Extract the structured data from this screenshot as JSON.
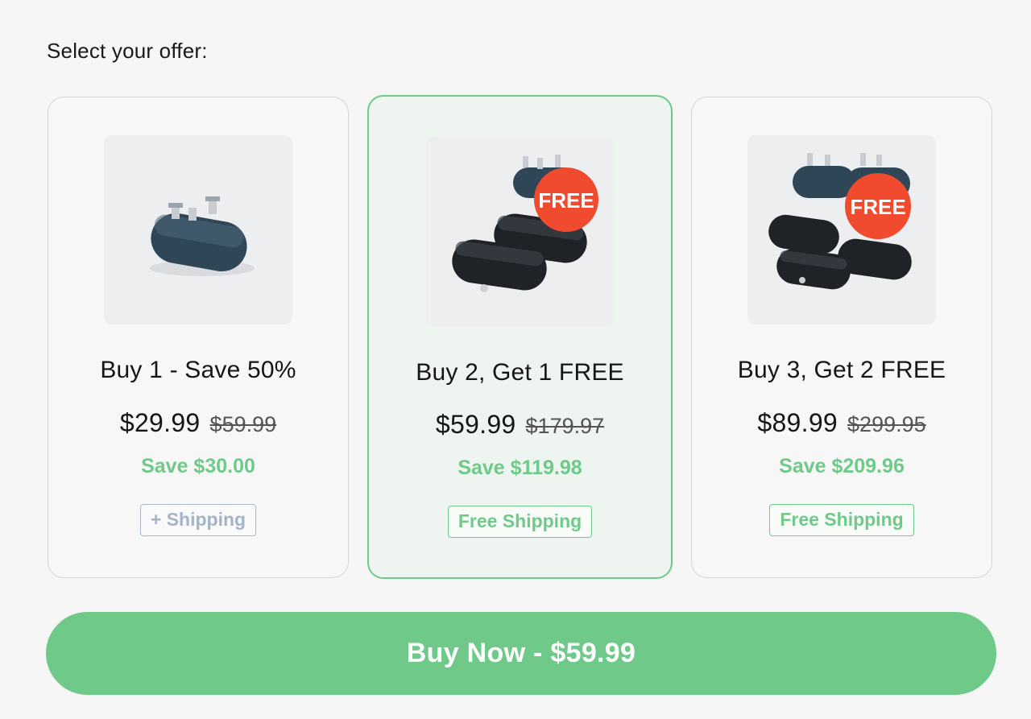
{
  "page": {
    "heading": "Select your offer:"
  },
  "colors": {
    "accent": "#6fca8a",
    "badge": "#f04a2f",
    "muted_border": "#a9b7c8"
  },
  "offers": [
    {
      "title": "Buy 1 - Save 50%",
      "price": "$29.99",
      "old_price": "$59.99",
      "savings": "Save $30.00",
      "shipping": "+ Shipping",
      "image": "single-charger",
      "selected": false
    },
    {
      "title": "Buy 2, Get 1 FREE",
      "price": "$59.99",
      "old_price": "$179.97",
      "savings": "Save $119.98",
      "shipping": "Free Shipping",
      "image": "three-chargers",
      "badge": "FREE",
      "selected": true
    },
    {
      "title": "Buy 3, Get 2 FREE",
      "price": "$89.99",
      "old_price": "$299.95",
      "savings": "Save $209.96",
      "shipping": "Free Shipping",
      "image": "five-chargers",
      "badge": "FREE",
      "selected": false
    }
  ],
  "buy_button": {
    "label": "Buy Now - $59.99"
  }
}
